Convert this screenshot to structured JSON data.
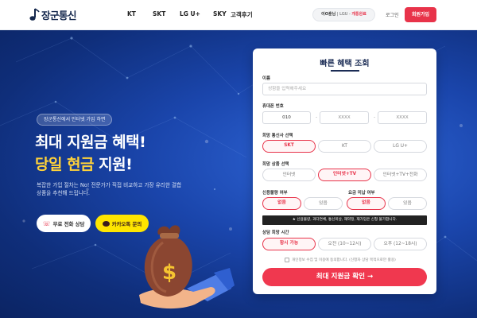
{
  "header": {
    "logo_text": "장군통신",
    "nav": [
      "KT",
      "SKT",
      "LG U+",
      "SKY",
      "고객후기"
    ],
    "notice_name": "이O훈님",
    "notice_sep": " | LGU - ",
    "notice_status": "개통완료",
    "login_label": "로그인",
    "signup_label": "회원가입"
  },
  "hero": {
    "badge": "장군통신에서 인터넷 가입 하면",
    "headline_line1": "최대 지원금 혜택!",
    "headline_line2_highlight": "당일 현금",
    "headline_line2_rest": " 지원!",
    "description": "복잡한 가입 절차는 No! 전문가가 직접 비교하고 가장 유리한 결합 상품을 추천해 드립니다.",
    "call_button": "무료 전화 상담",
    "kakao_button": "카카오톡 문의",
    "money_symbol": "$"
  },
  "form": {
    "title": "빠른 혜택 조회",
    "name_label": "이름",
    "name_placeholder": "성함을 입력해주세요",
    "phone_label": "휴대폰 번호",
    "phone_prefix": "010",
    "phone_mid_placeholder": "XXXX",
    "phone_last_placeholder": "XXXX",
    "phone_dash": "-",
    "carrier_label": "희망 통신사 선택",
    "carriers": [
      "SKT",
      "KT",
      "LG U+"
    ],
    "carrier_selected": "SKT",
    "product_label": "희망 상품 선택",
    "products": [
      "인터넷",
      "인터넷+TV",
      "인터넷+TV+전화"
    ],
    "product_selected": "인터넷+TV",
    "credit_label": "신용불량 여부",
    "credit_options": [
      "없음",
      "있음"
    ],
    "credit_selected": "없음",
    "unpaid_label": "요금 미납 여부",
    "unpaid_options": [
      "없음",
      "있음"
    ],
    "unpaid_selected": "없음",
    "required_mark": "*",
    "warning": "★ 신용불량, 과다연체, 통신미납, 재약정, 재가입은 신청 불가합니다.",
    "time_label": "상담 희망 시간",
    "times": [
      "항시 가능",
      "오전 (10~12시)",
      "오후 (12~18시)"
    ],
    "time_selected": "항시 가능",
    "agree_text": "개인정보 수집 및 이용에 동의합니다. (신청자 상담 목적으로만 활용)",
    "submit_label": "최대 지원금 확인 →"
  },
  "colors": {
    "accent": "#e8334a",
    "navy": "#1b2c55",
    "hero": "#1a45ab",
    "kakao": "#fee500"
  },
  "icons": [
    "logo-note-icon",
    "phone-icon",
    "kakao-chat-icon",
    "money-bag-icon",
    "hand-icon",
    "checkbox-icon"
  ]
}
